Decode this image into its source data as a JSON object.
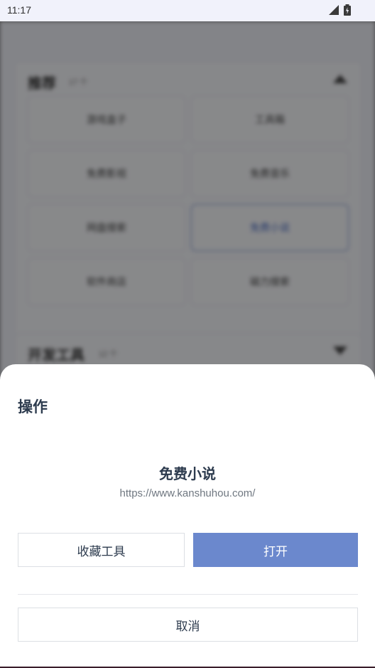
{
  "status_bar": {
    "time": "11:17",
    "icons": [
      "signal-icon",
      "battery-icon"
    ]
  },
  "background": {
    "card1": {
      "title": "推荐",
      "subtitle": "17 个",
      "items": [
        "游戏盒子",
        "工具箱",
        "免费影视",
        "免费音乐",
        "网盘搜索",
        "免费小说",
        "软件商店",
        "磁力搜索"
      ]
    },
    "card2": {
      "title": "开发工具",
      "subtitle": "12 个"
    }
  },
  "sheet": {
    "title": "操作",
    "tool_name": "免费小说",
    "tool_url": "https://www.kanshuhou.com/",
    "favorite_label": "收藏工具",
    "open_label": "打开",
    "cancel_label": "取消"
  },
  "colors": {
    "accent": "#6b88cd",
    "text": "#2d3b4e",
    "muted": "#6f7780"
  }
}
